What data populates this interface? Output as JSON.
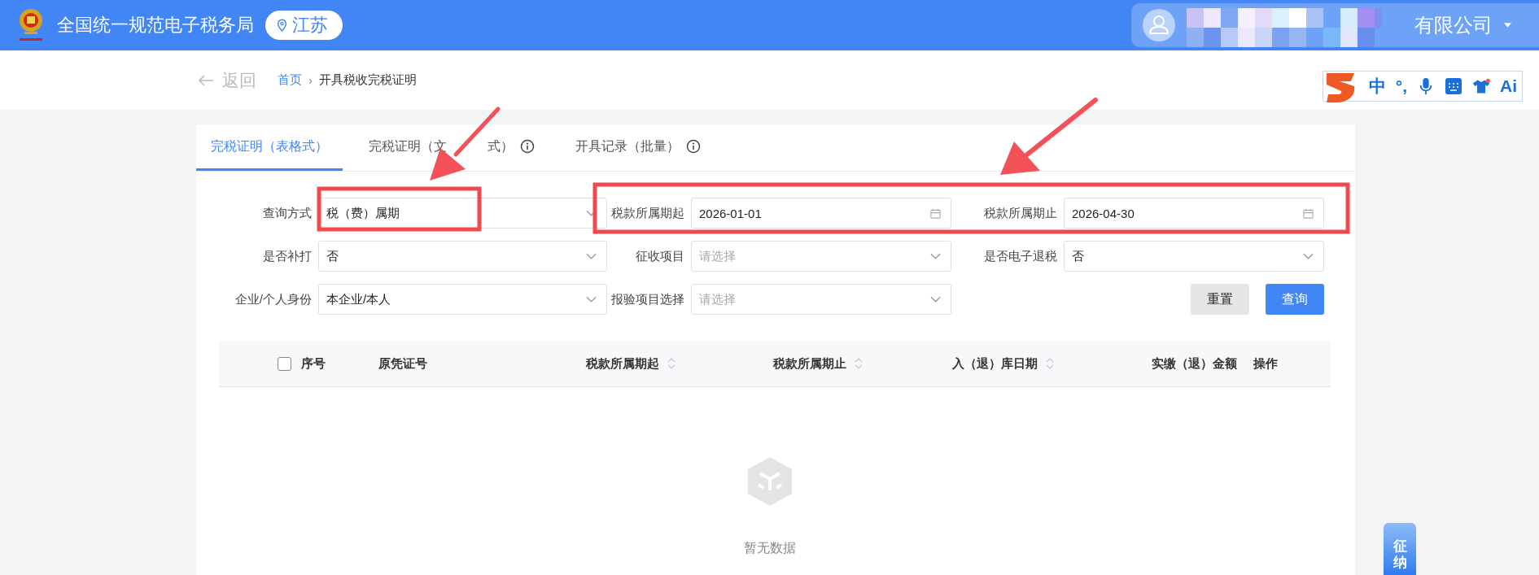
{
  "header": {
    "title": "全国统一规范电子税务局",
    "region": "江苏",
    "company": "有限公司"
  },
  "breadcrumb": {
    "back": "返回",
    "separator": "›",
    "items": [
      {
        "label": "首页",
        "link": true
      },
      {
        "label": "开具税收完税证明",
        "link": false
      }
    ]
  },
  "ime_toolbar": {
    "language": "中",
    "punctuation": "°,",
    "ai": "Ai"
  },
  "tabs": [
    {
      "label": "完税证明（表格式）",
      "selected": true,
      "info": false
    },
    {
      "label": "完税证明（文",
      "label_tail": "式）",
      "selected": false,
      "info": true
    },
    {
      "label": "开具记录（批量）",
      "selected": false,
      "info": true
    }
  ],
  "form": {
    "fields": [
      {
        "label": "查询方式",
        "kind": "select",
        "value": "税（费）属期"
      },
      {
        "label": "税款所属期起",
        "kind": "date",
        "value": "2026-01-01"
      },
      {
        "label": "税款所属期止",
        "kind": "date",
        "value": "2026-04-30"
      },
      {
        "label": "是否补打",
        "kind": "select",
        "value": "否"
      },
      {
        "label": "征收项目",
        "kind": "select",
        "placeholder": "请选择"
      },
      {
        "label": "是否电子退税",
        "kind": "select",
        "value": "否"
      },
      {
        "label": "企业/个人身份",
        "kind": "select",
        "value": "本企业/本人"
      },
      {
        "label": "报验项目选择",
        "kind": "select",
        "placeholder": "请选择"
      }
    ],
    "buttons": [
      {
        "label": "重置",
        "primary": false
      },
      {
        "label": "查询",
        "primary": true
      }
    ]
  },
  "table": {
    "select_all": {
      "checked": false
    },
    "columns": [
      {
        "label": "序号",
        "sortable": false
      },
      {
        "label": "原凭证号",
        "sortable": false
      },
      {
        "label": "税款所属期起",
        "sortable": true
      },
      {
        "label": "税款所属期止",
        "sortable": true
      },
      {
        "label": "入（退）库日期",
        "sortable": true
      },
      {
        "label": "实缴（退）金额",
        "sortable": false
      },
      {
        "label": "操作",
        "sortable": false
      }
    ],
    "empty_text": "暂无数据"
  },
  "side_tab": {
    "label": "征纳"
  }
}
